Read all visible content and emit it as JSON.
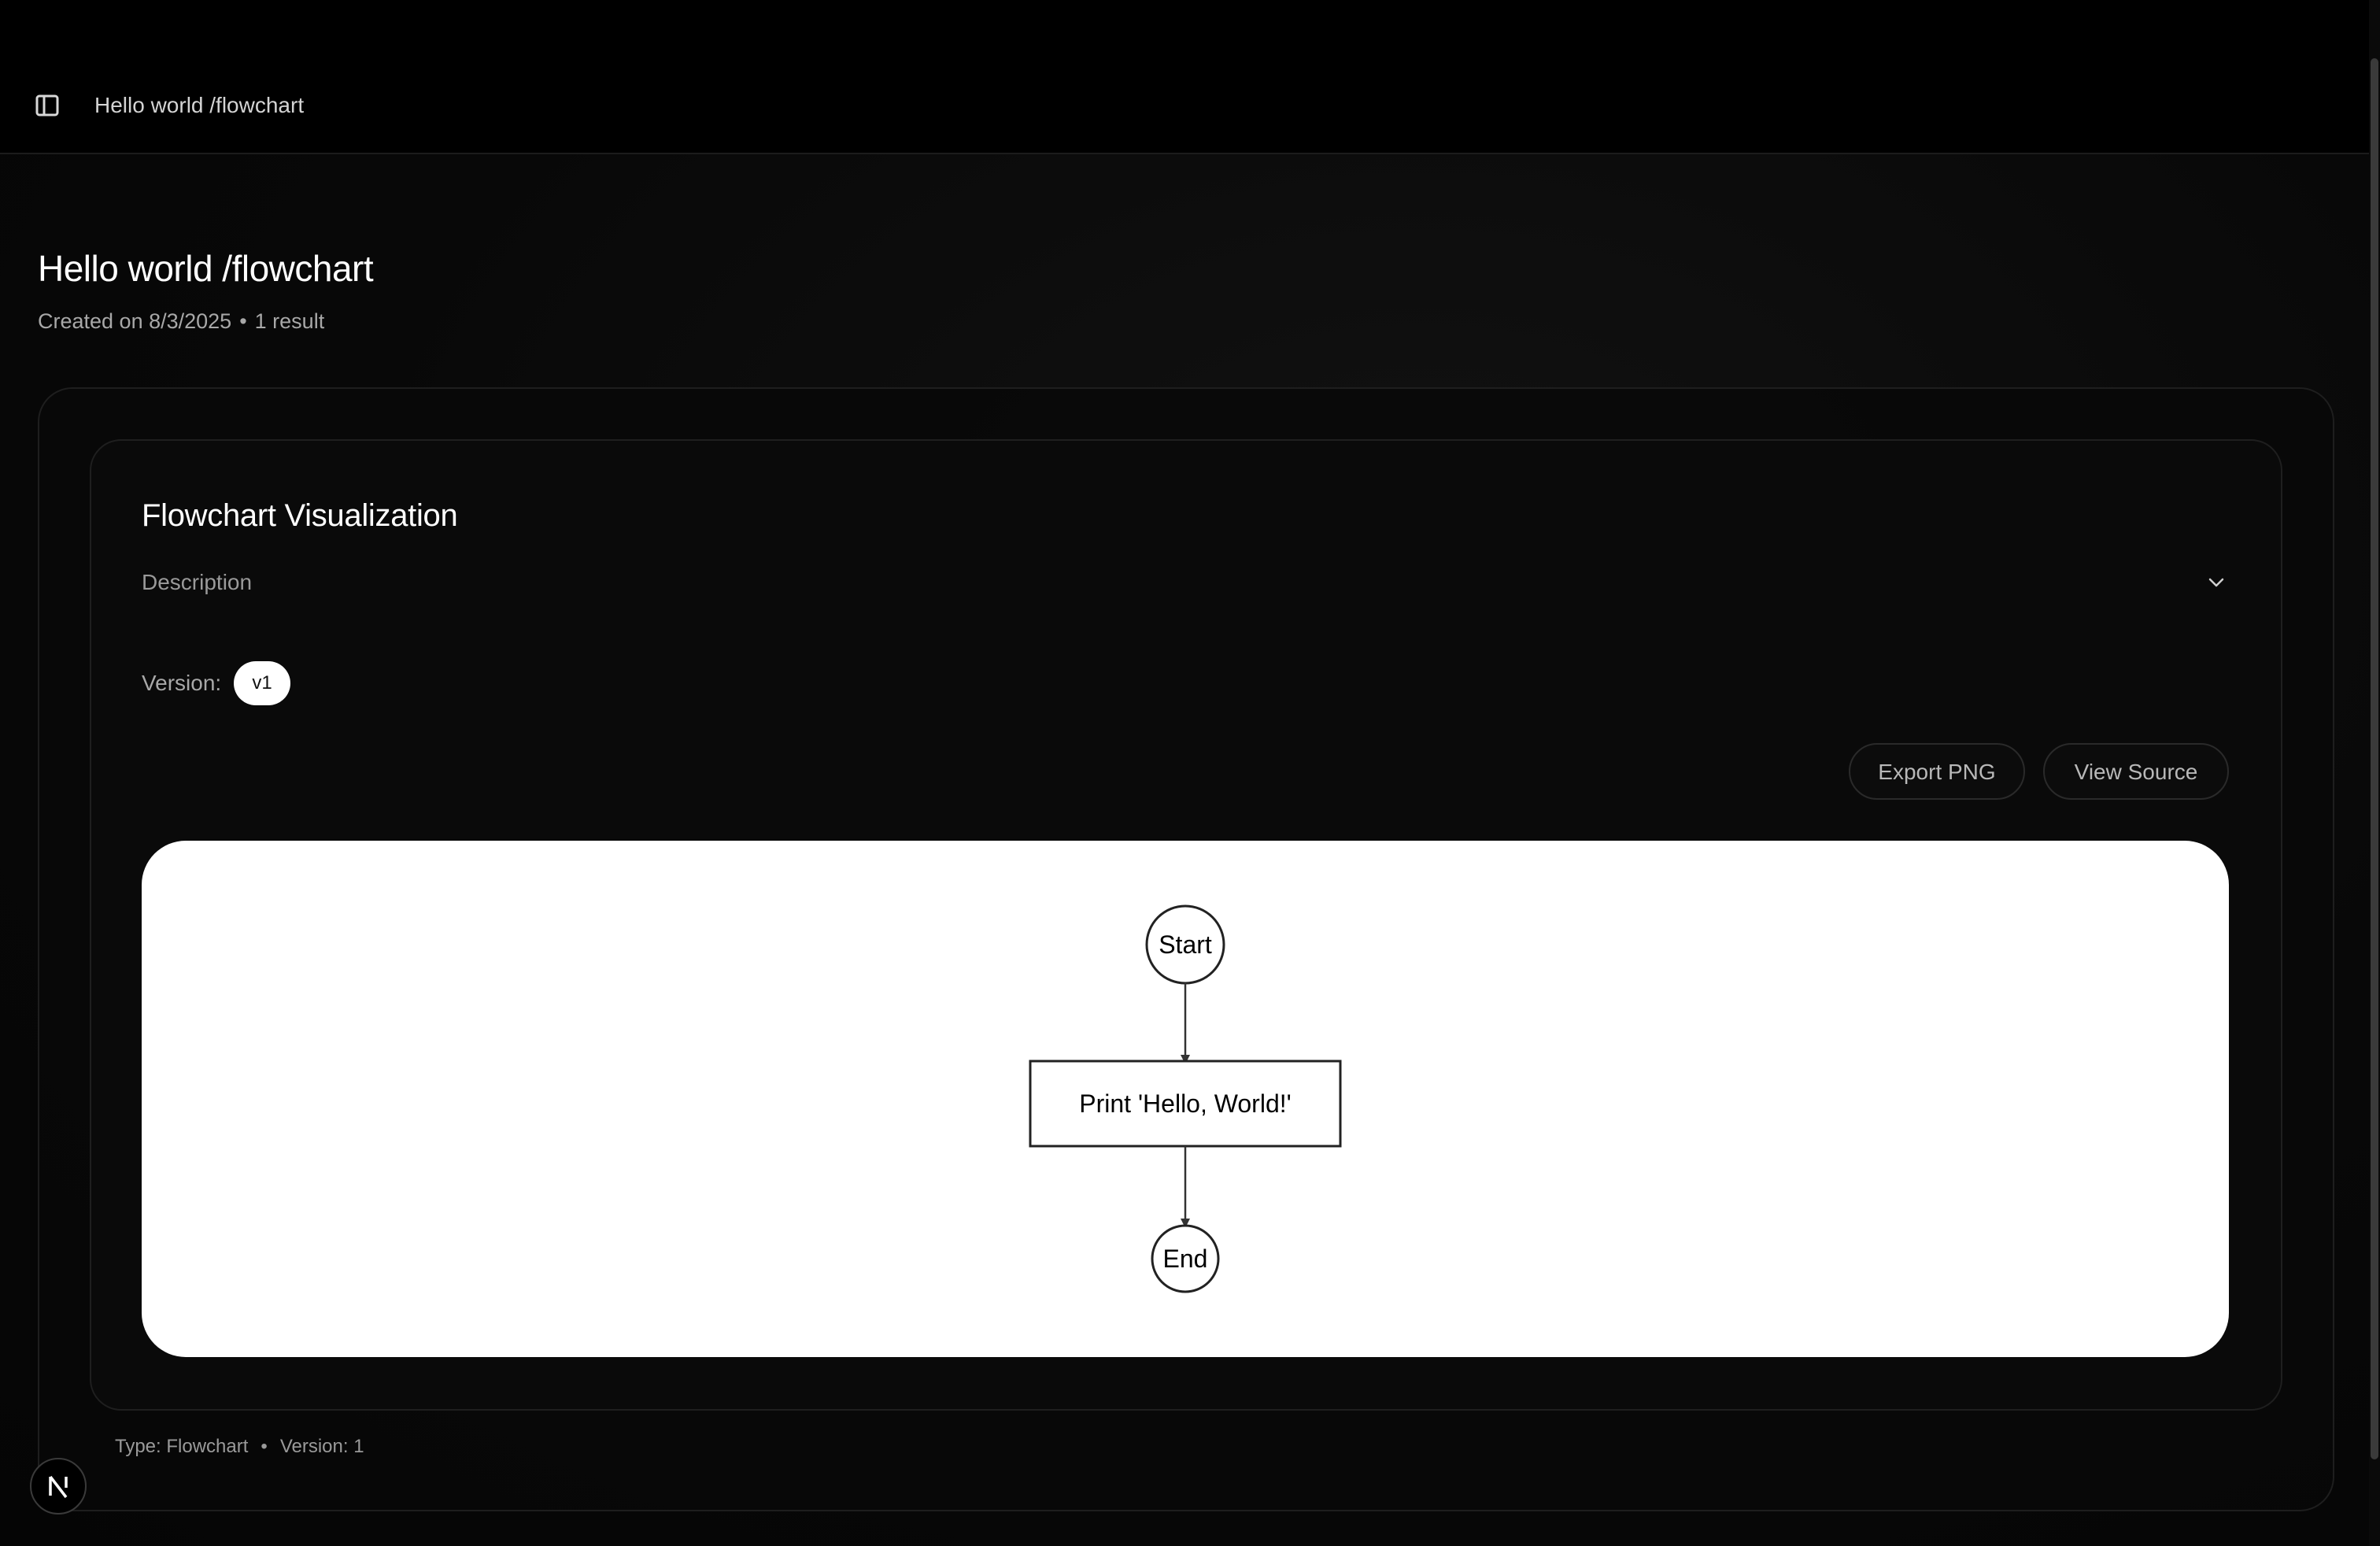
{
  "header": {
    "breadcrumb": "Hello world /flowchart",
    "sidebar_toggle_icon": "sidebar-panel-icon"
  },
  "page": {
    "title": "Hello world /flowchart",
    "created": "Created on 8/3/2025",
    "results": "1 result"
  },
  "artifact": {
    "title": "Flowchart Visualization",
    "description_label": "Description",
    "version_label": "Version:",
    "version_value": "v1",
    "export_label": "Export PNG",
    "view_source_label": "View Source",
    "flowchart": {
      "start": "Start",
      "process": "Print 'Hello, World!'",
      "end": "End"
    }
  },
  "footer": {
    "type": "Type: Flowchart",
    "version": "Version: 1"
  },
  "colors": {
    "background": "#000000",
    "canvas": "#ffffff",
    "accent_pill": "#ffffff"
  }
}
